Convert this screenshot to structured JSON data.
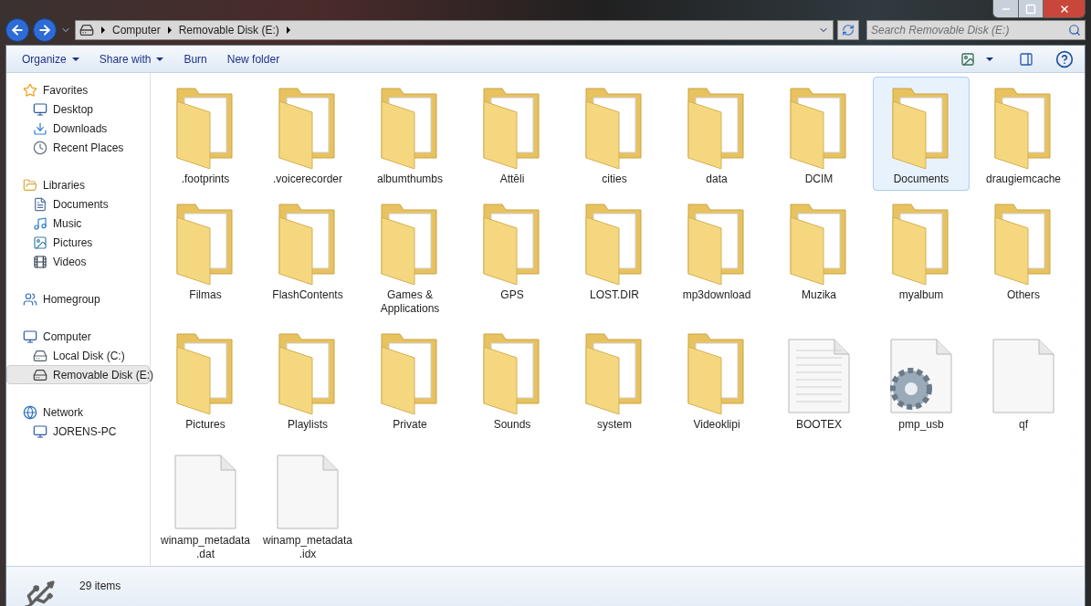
{
  "address": {
    "crumbs": [
      "Computer",
      "Removable Disk (E:)"
    ]
  },
  "search": {
    "placeholder": "Search Removable Disk (E:)"
  },
  "toolbar": [
    {
      "label": "Organize",
      "menu": true
    },
    {
      "label": "Share with",
      "menu": true
    },
    {
      "label": "Burn",
      "menu": false
    },
    {
      "label": "New folder",
      "menu": false
    }
  ],
  "sidebar": [
    {
      "label": "Favorites",
      "kind": "star",
      "selected": false,
      "children": [
        {
          "label": "Desktop",
          "kind": "desktop",
          "selected": false
        },
        {
          "label": "Downloads",
          "kind": "downloads",
          "selected": false
        },
        {
          "label": "Recent Places",
          "kind": "recent",
          "selected": false
        }
      ]
    },
    {
      "label": "Libraries",
      "kind": "library",
      "selected": false,
      "children": [
        {
          "label": "Documents",
          "kind": "documents",
          "selected": false
        },
        {
          "label": "Music",
          "kind": "music",
          "selected": false
        },
        {
          "label": "Pictures",
          "kind": "pictures",
          "selected": false
        },
        {
          "label": "Videos",
          "kind": "videos",
          "selected": false
        }
      ]
    },
    {
      "label": "Homegroup",
      "kind": "homegroup",
      "selected": false
    },
    {
      "label": "Computer",
      "kind": "computer",
      "selected": false,
      "children": [
        {
          "label": "Local Disk (C:)",
          "kind": "disk",
          "selected": false
        },
        {
          "label": "Removable Disk (E:)",
          "kind": "usb",
          "selected": true
        }
      ]
    },
    {
      "label": "Network",
      "kind": "network",
      "selected": false,
      "children": [
        {
          "label": "JORENS-PC",
          "kind": "computer",
          "selected": false
        }
      ]
    }
  ],
  "items": [
    {
      "name": ".footprints",
      "kind": "folder",
      "selected": false
    },
    {
      "name": ".voicerecorder",
      "kind": "folder",
      "selected": false
    },
    {
      "name": "albumthumbs",
      "kind": "folder",
      "selected": false
    },
    {
      "name": "Attēli",
      "kind": "folder",
      "selected": false
    },
    {
      "name": "cities",
      "kind": "folder",
      "selected": false
    },
    {
      "name": "data",
      "kind": "folder",
      "selected": false
    },
    {
      "name": "DCIM",
      "kind": "folder",
      "selected": false
    },
    {
      "name": "Documents",
      "kind": "folder",
      "selected": true
    },
    {
      "name": "draugiemcache",
      "kind": "folder",
      "selected": false
    },
    {
      "name": "Filmas",
      "kind": "folder",
      "selected": false
    },
    {
      "name": "FlashContents",
      "kind": "folder",
      "selected": false
    },
    {
      "name": "Games & Applications",
      "kind": "folder",
      "selected": false
    },
    {
      "name": "GPS",
      "kind": "folder",
      "selected": false
    },
    {
      "name": "LOST.DIR",
      "kind": "folder",
      "selected": false
    },
    {
      "name": "mp3download",
      "kind": "folder",
      "selected": false
    },
    {
      "name": "Muzika",
      "kind": "folder",
      "selected": false
    },
    {
      "name": "myalbum",
      "kind": "folder",
      "selected": false
    },
    {
      "name": "Others",
      "kind": "folder",
      "selected": false
    },
    {
      "name": "Pictures",
      "kind": "folder",
      "selected": false
    },
    {
      "name": "Playlists",
      "kind": "folder",
      "selected": false
    },
    {
      "name": "Private",
      "kind": "folder",
      "selected": false
    },
    {
      "name": "Sounds",
      "kind": "folder",
      "selected": false
    },
    {
      "name": "system",
      "kind": "folder",
      "selected": false
    },
    {
      "name": "Videoklipi",
      "kind": "folder",
      "selected": false
    },
    {
      "name": "BOOTEX",
      "kind": "text",
      "selected": false
    },
    {
      "name": "pmp_usb",
      "kind": "settings",
      "selected": false
    },
    {
      "name": "qf",
      "kind": "file",
      "selected": false
    },
    {
      "name": "winamp_metadata.dat",
      "kind": "file",
      "selected": false
    },
    {
      "name": "winamp_metadata.idx",
      "kind": "file",
      "selected": false
    }
  ],
  "status": {
    "count": "29 items"
  }
}
